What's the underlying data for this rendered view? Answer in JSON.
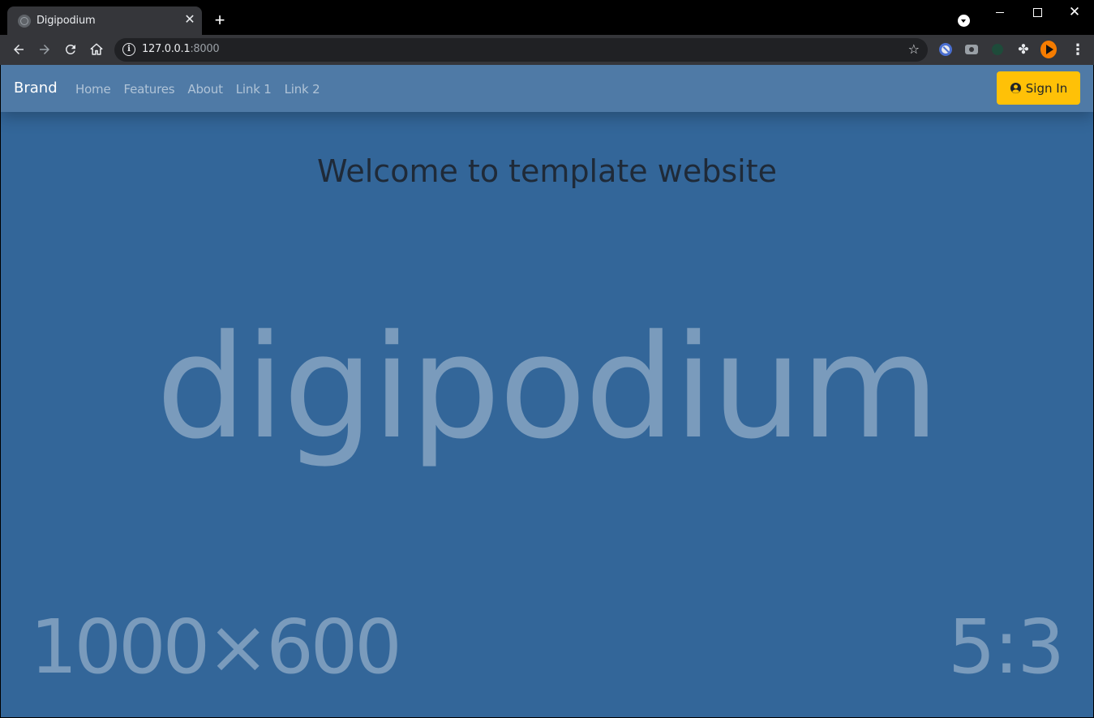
{
  "browser": {
    "tab_title": "Digipodium",
    "tab_close": "✕",
    "new_tab": "+",
    "url_host": "127.0.0.1",
    "url_port": ":8000",
    "icons": [
      "back-icon",
      "forward-icon",
      "reload-icon",
      "home-icon",
      "info-icon",
      "star-icon",
      "puzzle-icon",
      "menu-icon"
    ]
  },
  "navbar": {
    "brand": "Brand",
    "links": [
      "Home",
      "Features",
      "About",
      "Link 1",
      "Link 2"
    ],
    "signin_label": "Sign In",
    "colors": {
      "background": "#4f7aa6",
      "signin": "#ffc107"
    }
  },
  "main": {
    "title": "Welcome to template website",
    "placeholder": {
      "word": "digipodium",
      "size": "1000×600",
      "ratio": "5:3",
      "background": "#336699"
    }
  }
}
